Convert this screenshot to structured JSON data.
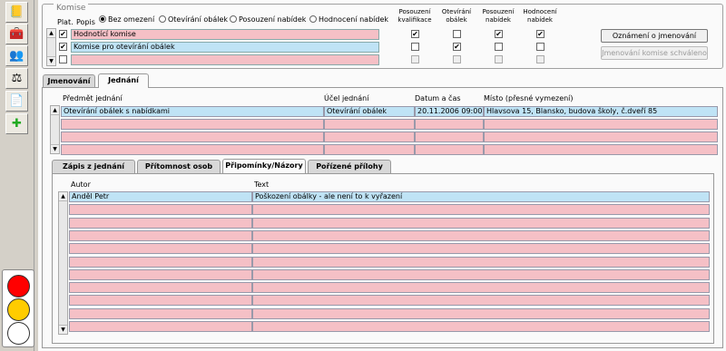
{
  "komise": {
    "legend": "Komise",
    "col_plat": "Plat.",
    "col_popis": "Popis",
    "filters": [
      "Bez omezení",
      "Otevírání obálek",
      "Posouzení nabídek",
      "Hodnocení nabídek"
    ],
    "selected_filter": "Bez omezení",
    "flag_headers": [
      [
        "Posouzení",
        "kvalifikace"
      ],
      [
        "Otevírání",
        "obálek"
      ],
      [
        "Posouzení",
        "nabídek"
      ],
      [
        "Hodnocení",
        "nabídek"
      ]
    ],
    "rows": [
      {
        "plat": true,
        "popis": "Hodnotící komise",
        "flags": [
          true,
          false,
          true,
          true
        ],
        "selected": false
      },
      {
        "plat": true,
        "popis": "Komise pro otevírání obálek",
        "flags": [
          false,
          true,
          false,
          false
        ],
        "selected": true
      },
      {
        "plat": false,
        "popis": "",
        "flags": [
          false,
          false,
          false,
          false
        ],
        "selected": false
      }
    ],
    "btn_oznameni": "Oznámení o jmenování",
    "btn_schvaleno": "Jmenování komise schváleno"
  },
  "tabs_top": [
    "Jmenování",
    "Jednání"
  ],
  "active_top_tab": "Jednání",
  "jednani": {
    "headers": [
      "Předmět jednání",
      "Účel jednání",
      "Datum a čas",
      "Místo (přesné vymezení)"
    ],
    "rows": [
      [
        "Otevírání obálek s nabídkami",
        "Otevírání obálek",
        "20.11.2006 09:00",
        "Hlavsova 15, Blansko, budova školy, č.dveří 85"
      ],
      [
        "",
        "",
        "",
        ""
      ],
      [
        "",
        "",
        "",
        ""
      ],
      [
        "",
        "",
        "",
        ""
      ]
    ]
  },
  "tabs_sub": [
    "Zápis z jednání",
    "Přítomnost osob",
    "Připomínky/Názory",
    "Pořízené přílohy"
  ],
  "active_sub_tab": "Připomínky/Názory",
  "pripominky": {
    "headers": [
      "Autor",
      "Text"
    ],
    "rows": [
      [
        "Anděl Petr",
        "Poškození obálky - ale není to k vyřazení"
      ],
      [
        "",
        ""
      ],
      [
        "",
        ""
      ],
      [
        "",
        ""
      ],
      [
        "",
        ""
      ],
      [
        "",
        ""
      ],
      [
        "",
        ""
      ],
      [
        "",
        ""
      ],
      [
        "",
        ""
      ],
      [
        "",
        ""
      ],
      [
        "",
        ""
      ]
    ]
  },
  "sidebar_icons": [
    "notebook-icon",
    "toolbox-icon",
    "people-icon",
    "scales-icon",
    "document-icon",
    "add-document-icon"
  ],
  "traffic_light": {
    "red": "#ff0000",
    "amber": "#ffcc00",
    "green": "#ffffff"
  }
}
